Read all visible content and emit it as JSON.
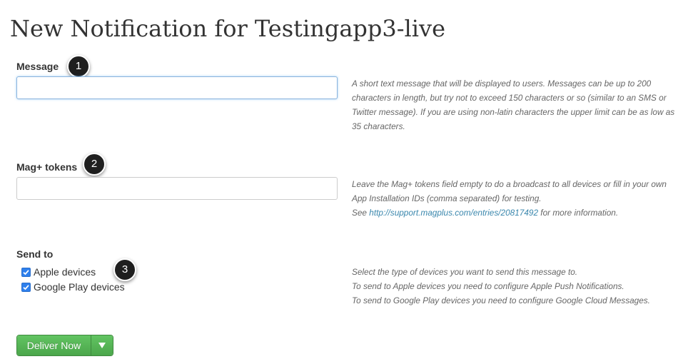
{
  "page": {
    "title": "New Notification for Testingapp3-live"
  },
  "message": {
    "label": "Message",
    "value": "",
    "marker": "1",
    "help": [
      "A short text message that will be displayed to users. Messages can be up to 200",
      "characters in length, but try not to exceed 150 characters or so (similar to an SMS or",
      "Twitter message). If you are using non-latin characters the upper limit can be as low as",
      "35 characters."
    ]
  },
  "tokens": {
    "label": "Mag+ tokens",
    "value": "",
    "marker": "2",
    "help_line1": "Leave the Mag+ tokens field empty to do a broadcast to all devices or fill in your own",
    "help_line2": "App Installation IDs (comma separated) for testing.",
    "help_see": "See ",
    "help_link": "http://support.magplus.com/entries/20817492",
    "help_after": " for more information."
  },
  "send_to": {
    "label": "Send to",
    "marker": "3",
    "options": [
      {
        "label": "Apple devices",
        "checked": true
      },
      {
        "label": "Google Play devices",
        "checked": true
      }
    ],
    "help": [
      "Select the type of devices you want to send this message to.",
      "To send to Apple devices you need to configure Apple Push Notifications.",
      "To send to Google Play devices you need to configure Google Cloud Messages."
    ]
  },
  "actions": {
    "deliver_label": "Deliver Now",
    "caret_icon": "caret-down-icon",
    "button_color": "#5bb75b"
  },
  "colors": {
    "link": "#3a87ad",
    "checkbox": "#2f80ed",
    "marker": "#1f1f1f"
  }
}
